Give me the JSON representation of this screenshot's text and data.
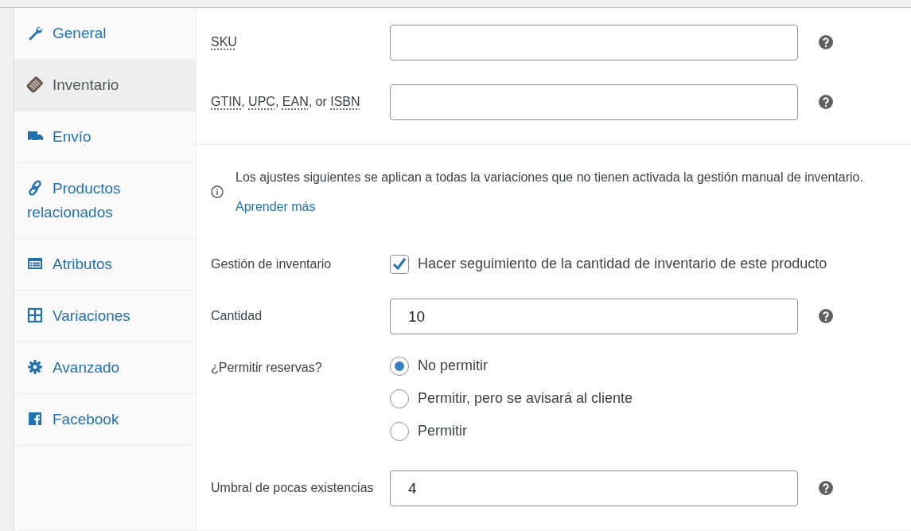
{
  "sidebar": {
    "items": [
      {
        "label": "General",
        "selected": false
      },
      {
        "label": "Inventario",
        "selected": true
      },
      {
        "label": "Envío",
        "selected": false
      },
      {
        "label": "Productos relacionados",
        "selected": false
      },
      {
        "label": "Atributos",
        "selected": false
      },
      {
        "label": "Variaciones",
        "selected": false
      },
      {
        "label": "Avanzado",
        "selected": false
      },
      {
        "label": "Facebook",
        "selected": false
      }
    ]
  },
  "sections": [
    {
      "kind": "field",
      "label_parts": [
        {
          "text": "SKU",
          "abbr": true
        }
      ]
    },
    {
      "kind": "field",
      "label_parts": [
        {
          "text": "GTIN",
          "abbr": true
        },
        {
          "text": ", ",
          "abbr": false
        },
        {
          "text": "UPC",
          "abbr": true
        },
        {
          "text": ", ",
          "abbr": false
        },
        {
          "text": "EAN",
          "abbr": true
        },
        {
          "text": ", or ",
          "abbr": false
        },
        {
          "text": "ISBN",
          "abbr": true
        }
      ]
    },
    {
      "kind": "divider"
    },
    {
      "kind": "notice",
      "text": "Los ajustes siguientes se aplican a todas la variaciones que no tienen activada la gestión manual de inventario.",
      "link": "Aprender más"
    },
    {
      "kind": "checkbox",
      "label": "Gestión de inventario",
      "option": "Hacer seguimiento de la cantidad de inventario de este producto",
      "checked": true
    },
    {
      "kind": "field",
      "label_parts": [
        {
          "text": "Cantidad",
          "abbr": false
        }
      ],
      "value": "10"
    },
    {
      "kind": "radio",
      "label": "¿Permitir reservas?",
      "options": [
        {
          "label": "No permitir",
          "selected": true
        },
        {
          "label": "Permitir, pero se avisará al cliente",
          "selected": false
        },
        {
          "label": "Permitir",
          "selected": false
        }
      ]
    },
    {
      "kind": "field",
      "label_parts": [
        {
          "text": "Umbral de pocas existencias",
          "abbr": false
        }
      ],
      "value": "4"
    }
  ]
}
